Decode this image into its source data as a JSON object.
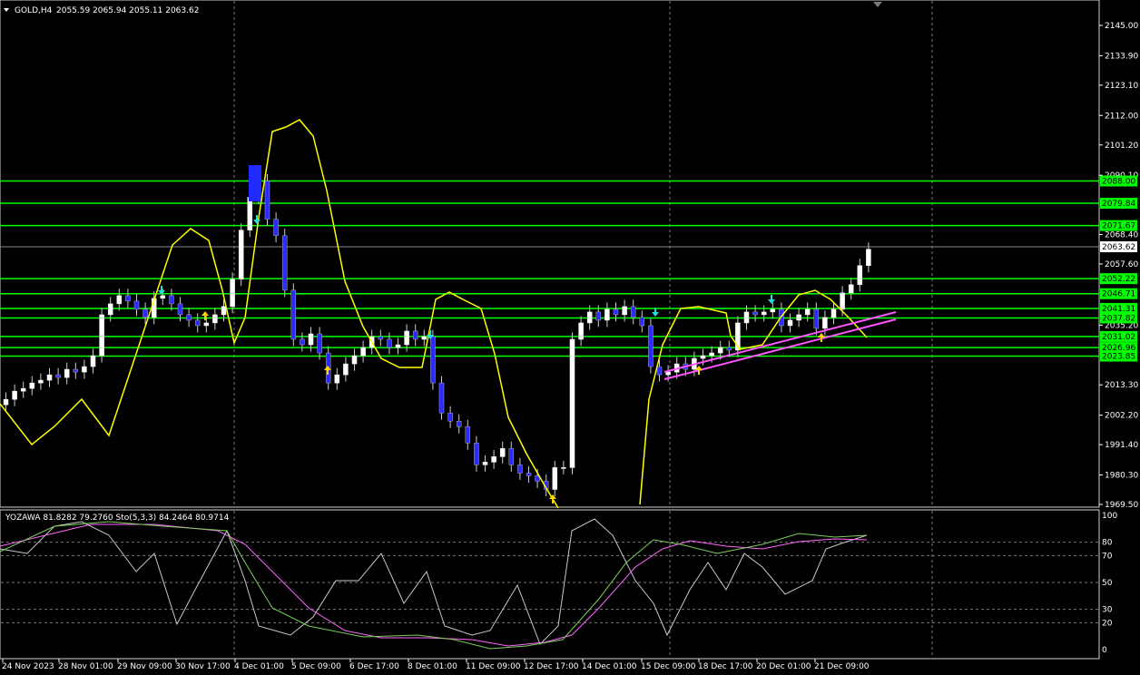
{
  "header": {
    "symbol_label": "GOLD,H4",
    "ohlc": "2055.59 2065.94 2055.11 2063.62"
  },
  "sub_header": "YOZAWA 81.8282 79.2760  Sto(5,3,3) 84.2464 80.9714",
  "colors": {
    "background": "#000000",
    "grid": "#7a7a7a",
    "level_line": "#00ff00",
    "bull_candle": "#ffffff",
    "bear_candle": "#2b2bff",
    "band": "#ffff00",
    "trend_channel": "#ff55ff",
    "arrow_up": "#ffd400",
    "arrow_down": "#22dddd",
    "stoch_main": "#c8c8c8",
    "stoch_signal": "#ff66ff",
    "yozawa": "#7ccf5a",
    "axis_text": "#ffffff",
    "current_price_bg": "#ffffff"
  },
  "price_axis": [
    "2145.00",
    "2133.90",
    "2123.10",
    "2112.00",
    "2101.20",
    "2090.10",
    "2068.40",
    "2057.60",
    "2035.20",
    "2013.30",
    "2002.20",
    "1991.40",
    "1980.30",
    "1969.50"
  ],
  "levels": [
    {
      "price": 2088.0,
      "label": "2088.00"
    },
    {
      "price": 2079.84,
      "label": "2079.84"
    },
    {
      "price": 2071.67,
      "label": "2071.67"
    },
    {
      "price": 2052.22,
      "label": "2052.22"
    },
    {
      "price": 2046.71,
      "label": "2046.71"
    },
    {
      "price": 2041.31,
      "label": "2041.31"
    },
    {
      "price": 2037.82,
      "label": "2037.82"
    },
    {
      "price": 2031.02,
      "label": "2031.02"
    },
    {
      "price": 2026.96,
      "label": "2026.96"
    },
    {
      "price": 2023.85,
      "label": "2023.85"
    }
  ],
  "current_price": "2063.62",
  "osc_axis": [
    "100",
    "80",
    "70",
    "50",
    "30",
    "20",
    "0"
  ],
  "time_axis": [
    "24 Nov 2023",
    "28 Nov 01:00",
    "29 Nov 09:00",
    "30 Nov 17:00",
    "4 Dec 01:00",
    "5 Dec 09:00",
    "6 Dec 17:00",
    "8 Dec 01:00",
    "11 Dec 09:00",
    "12 Dec 17:00",
    "14 Dec 01:00",
    "15 Dec 09:00",
    "18 Dec 17:00",
    "20 Dec 01:00",
    "21 Dec 09:00"
  ]
}
